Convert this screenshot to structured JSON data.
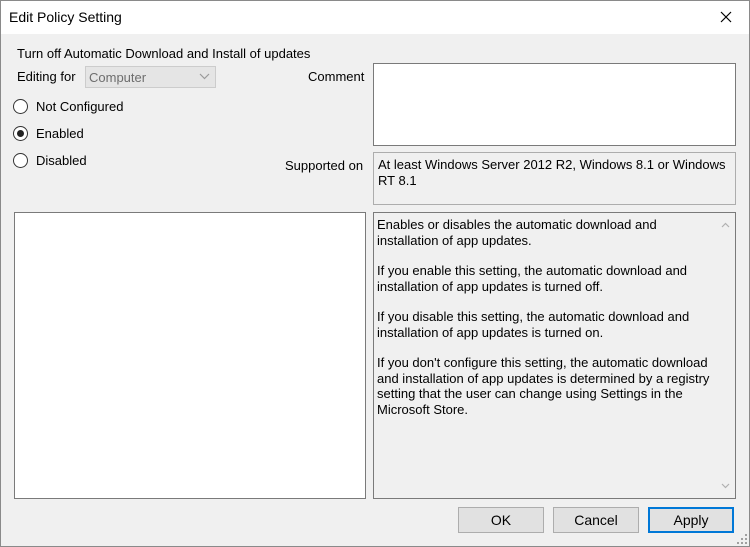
{
  "window": {
    "title": "Edit Policy Setting",
    "close_icon": "close-icon"
  },
  "policy": {
    "name": "Turn off Automatic Download and Install of updates",
    "editing_for_label": "Editing for",
    "editing_for_value": "Computer"
  },
  "comment": {
    "label": "Comment",
    "value": ""
  },
  "state": {
    "options": [
      {
        "label": "Not Configured",
        "checked": false
      },
      {
        "label": "Enabled",
        "checked": true
      },
      {
        "label": "Disabled",
        "checked": false
      }
    ]
  },
  "supported": {
    "label": "Supported on",
    "value": "At least Windows Server 2012 R2, Windows 8.1 or Windows RT 8.1"
  },
  "help": {
    "paragraphs": [
      "Enables or disables the automatic download and installation of app updates.",
      "If you enable this setting, the automatic download and installation of app updates is turned off.",
      "If you disable this setting, the automatic download and installation of app updates is turned on.",
      "If you don't configure this setting, the automatic download and installation of app updates is determined by a registry setting that the user can change using Settings in the Microsoft Store."
    ]
  },
  "buttons": {
    "ok": "OK",
    "cancel": "Cancel",
    "apply": "Apply"
  },
  "colors": {
    "accent": "#0078d7",
    "dialog_bg": "#f0f0f0"
  }
}
